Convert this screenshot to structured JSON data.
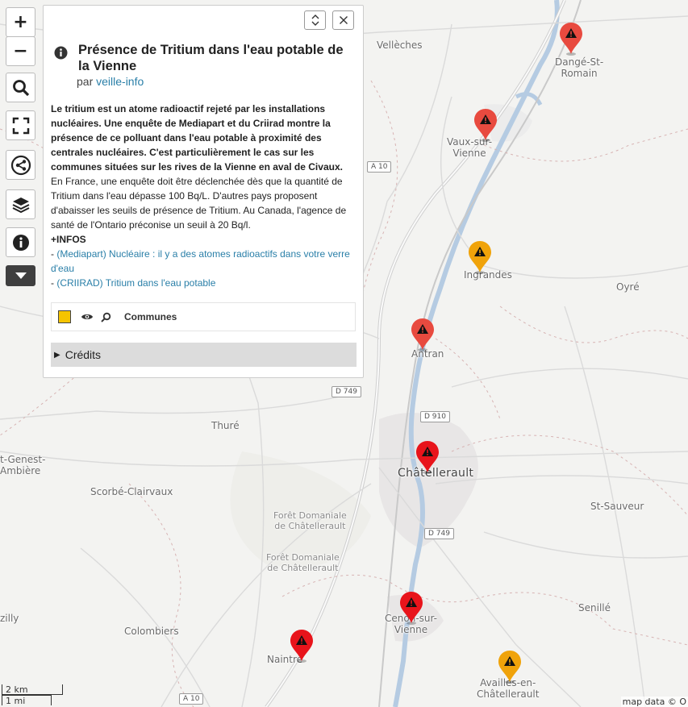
{
  "map": {
    "places": [
      {
        "id": "velleches",
        "label": "Vellèches"
      },
      {
        "id": "dange",
        "label": "Dangé-St-\nRomain"
      },
      {
        "id": "vaux",
        "label": "Vaux-sur-\nVienne"
      },
      {
        "id": "ingrandes",
        "label": "Ingrandes"
      },
      {
        "id": "oyre",
        "label": "Oyré"
      },
      {
        "id": "antran",
        "label": "Antran"
      },
      {
        "id": "thure",
        "label": "Thuré"
      },
      {
        "id": "chatellerault",
        "label": "Châtellerault"
      },
      {
        "id": "st-genest",
        "label": "t-Genest-\nAmbière"
      },
      {
        "id": "scorbe",
        "label": "Scorbé-Clairvaux"
      },
      {
        "id": "st-sauveur",
        "label": "St-Sauveur"
      },
      {
        "id": "foret1",
        "label": "Forêt Domaniale\nde Châtellerault"
      },
      {
        "id": "foret2",
        "label": "Forêt Domaniale\nde Châtellerault"
      },
      {
        "id": "cenon",
        "label": "Cenon-sur-\nVienne"
      },
      {
        "id": "senille",
        "label": "Senillé"
      },
      {
        "id": "colombiers",
        "label": "Colombiers"
      },
      {
        "id": "naintre",
        "label": "Naintré"
      },
      {
        "id": "availles",
        "label": "Availles-en-\nChâtellerault"
      },
      {
        "id": "zilly",
        "label": "zilly"
      }
    ],
    "roads": [
      {
        "id": "a10-top",
        "label": "A 10"
      },
      {
        "id": "d749-a",
        "label": "D 749"
      },
      {
        "id": "d910",
        "label": "D 910"
      },
      {
        "id": "d749-b",
        "label": "D 749"
      },
      {
        "id": "a10-bottom",
        "label": "A 10"
      }
    ],
    "markers": [
      {
        "id": "dange",
        "color": "#e84a3f",
        "level": "high"
      },
      {
        "id": "vaux",
        "color": "#e84a3f",
        "level": "high"
      },
      {
        "id": "ingrandes",
        "color": "#f0a30a",
        "level": "medium"
      },
      {
        "id": "antran",
        "color": "#e84a3f",
        "level": "high"
      },
      {
        "id": "chatellerault",
        "color": "#e8141b",
        "level": "very-high"
      },
      {
        "id": "cenon",
        "color": "#e8141b",
        "level": "very-high"
      },
      {
        "id": "naintre",
        "color": "#e8141b",
        "level": "very-high"
      },
      {
        "id": "availles",
        "color": "#f0a30a",
        "level": "medium"
      }
    ],
    "scale": {
      "metric": "2 km",
      "imperial": "1 mi"
    },
    "attribution": "map data © O"
  },
  "toolbar": {
    "zoom_in": "+",
    "zoom_out": "−",
    "icons": [
      "search-icon",
      "fullscreen-icon",
      "share-icon",
      "layers-icon",
      "info-icon",
      "caret-down-icon"
    ]
  },
  "panel": {
    "title": "Présence de Tritium dans l'eau potable de la Vienne",
    "by_prefix": "par",
    "author": "veille-info",
    "description_bold": "Le tritium est un atome radioactif rejeté par les installations nucléaires. Une enquête de Mediapart et du Criirad montre la présence de ce polluant dans l'eau potable à proximité des centrales nucléaires. C'est particulièrement le cas sur les communes situées sur les rives de la Vienne en aval de Civaux.",
    "description": "En France, une enquête doit être déclenchée dès que la quantité de Tritium dans l'eau dépasse 100 Bq/L. D'autres pays proposent d'abaisser les seuils de présence de Tritium. Au Canada, l'agence de santé de l'Ontario préconise un seuil à 20 Bq/l.",
    "infos_label": "+INFOS",
    "link1": "(Mediapart) Nucléaire : il y a des atomes radioactifs dans votre verre d'eau",
    "link2": "(CRIIRAD) Tritium dans l'eau potable",
    "layer_name": "Communes",
    "layer_color": "#f5c400",
    "credits_label": "Crédits"
  }
}
